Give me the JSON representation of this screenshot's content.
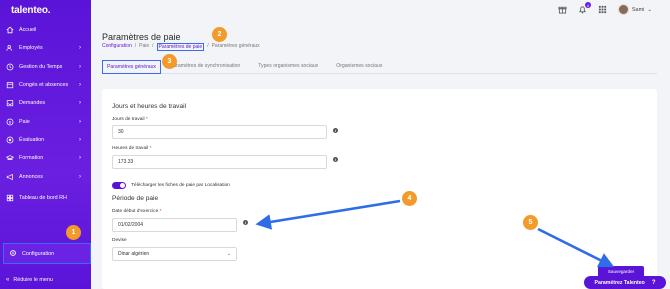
{
  "app": {
    "logo": "talenteo."
  },
  "sidebar": {
    "items": [
      {
        "label": "Accueil",
        "icon": "home-icon",
        "chevron": false
      },
      {
        "label": "Employés",
        "icon": "users-icon",
        "chevron": true
      },
      {
        "label": "Gestion du Temps",
        "icon": "clock-icon",
        "chevron": true
      },
      {
        "label": "Congés et absences",
        "icon": "calendar-icon",
        "chevron": true
      },
      {
        "label": "Demandes",
        "icon": "inbox-icon",
        "chevron": true
      },
      {
        "label": "Paie",
        "icon": "money-icon",
        "chevron": true
      },
      {
        "label": "Évaluation",
        "icon": "target-icon",
        "chevron": true
      },
      {
        "label": "Formation",
        "icon": "graduation-icon",
        "chevron": true
      },
      {
        "label": "Annonces",
        "icon": "megaphone-icon",
        "chevron": true
      },
      {
        "label": "Tableau de bord RH",
        "icon": "dashboard-icon",
        "chevron": false
      }
    ],
    "config_label": "Configuration",
    "reduce_label": "Réduire le menu"
  },
  "topbar": {
    "notification_count": "4",
    "user_name": "Sami"
  },
  "page": {
    "title": "Paramètres de paie",
    "breadcrumb": [
      "Configuration",
      "Paie",
      "Paramètres de paie",
      "Paramètres généraux"
    ],
    "tabs": [
      "Paramètres généraux",
      "Paramètres de synchronisation",
      "Types organismes sociaux",
      "Organismes sociaux"
    ],
    "active_tab": 0
  },
  "form": {
    "section1_title": "Jours et heures de travail",
    "jours_label": "Jours de travail",
    "jours_value": "30",
    "heures_label": "Heures de travail",
    "heures_value": "173.33",
    "toggle_label": "Télécharger les fiches de paie par Localisation",
    "section2_title": "Période de paie",
    "date_label": "Date début d'exercice",
    "date_value": "01/02/2004",
    "devise_label": "Devise",
    "devise_value": "Dinar algérien",
    "required_mark": "*",
    "info_mark": "i"
  },
  "buttons": {
    "save": "Sauvegarder",
    "help": "Paramétrez Talenteo",
    "help_mark": "?"
  },
  "annotations": {
    "badges": [
      "1",
      "2",
      "3",
      "4",
      "5"
    ],
    "accent_color": "#f29b2b",
    "arrow_color": "#2f6de8"
  },
  "colors": {
    "brand": "#5a14d8",
    "highlight": "#3b6cf0"
  }
}
